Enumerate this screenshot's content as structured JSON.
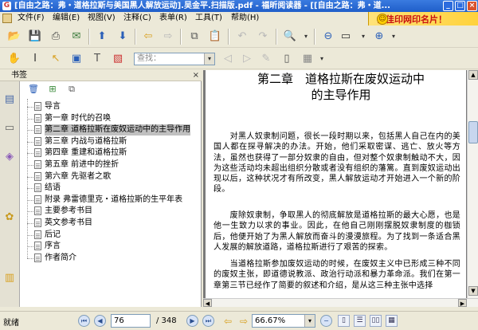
{
  "window": {
    "title": "[自由之路：弗・道格拉斯与美国黑人解放运动].吴金平.扫描版.pdf - 福昕阅读器 - [[自由之路：弗・道...",
    "app_icon": "G",
    "minimize": "_",
    "maximize": "□",
    "close": "×"
  },
  "menu": {
    "items": [
      "文件(F)",
      "编辑(E)",
      "视图(V)",
      "注释(C)",
      "表单(R)",
      "工具(T)",
      "帮助(H)"
    ],
    "ad_text": "去佳印网印名片！",
    "ad_smiley": "☺"
  },
  "toolbar": {
    "find_placeholder": "查找：",
    "find_dropdown": "▾"
  },
  "left_panel": {
    "header": "书签",
    "close": "×",
    "bookmarks": [
      {
        "label": "导言",
        "selected": false
      },
      {
        "label": "第一章 时代的召唤",
        "selected": false
      },
      {
        "label": "第二章 道格拉斯在废奴运动中的主导作用",
        "selected": true
      },
      {
        "label": "第三章 内战与道格拉斯",
        "selected": false
      },
      {
        "label": "第四章 重建和道格拉斯",
        "selected": false
      },
      {
        "label": "第五章 前进中的挫折",
        "selected": false
      },
      {
        "label": "第六章 先驱者之歌",
        "selected": false
      },
      {
        "label": "结语",
        "selected": false
      },
      {
        "label": "附录 弗雷德里克・道格拉斯的生平年表",
        "selected": false
      },
      {
        "label": "主要参考书目",
        "selected": false
      },
      {
        "label": "英文参考书目",
        "selected": false
      },
      {
        "label": "后记",
        "selected": false
      },
      {
        "label": "序言",
        "selected": false
      },
      {
        "label": "作者简介",
        "selected": false
      }
    ]
  },
  "document": {
    "chapter_title_line1": "第二章　道格拉斯在废奴运动中",
    "chapter_title_line2": "的主导作用",
    "paragraph1": "　　对黑人奴隶制问题，很长一段时期以来，包括黑人自己在内的美国人都在探寻解决的办法。开始，他们采取密谋、逃亡、放火等方法，虽然也获得了一部分奴隶的自由，但对整个奴隶制触动不大，因为这些活动均未超出组织分散或者没有组织的藩篱。直到废奴运动出现以后，这种状况才有所改变，黑人解放运动才开始进入一个新的阶段。",
    "paragraph2": "　　废除奴隶制，争取黑人的彻底解放是道格拉斯的最大心愿，也是他一生致力以求的事业。因此，在他自己刚刚摆脱奴隶制度的枷锁后，他便开始了为黑人解放而奋斗的漫漫旅程。为了找到一条适合黑人发展的解放道路，道格拉斯进行了艰苦的探索。",
    "paragraph3": "　　当道格拉斯参加废奴运动的时候，在废奴主义中已形成三种不同的废奴主张，即道德说教派、政治行动派和暴力革命派。我们在第一章第三节已经作了简要的叙述和介绍，是从这三种主张中选择"
  },
  "status": {
    "ready": "就绪",
    "current_page": "76",
    "page_total": "/ 348",
    "zoom": "66.67%",
    "zoom_dropdown": "▾",
    "first": "⏮",
    "prev": "◀",
    "next": "▶",
    "last": "⏭"
  }
}
